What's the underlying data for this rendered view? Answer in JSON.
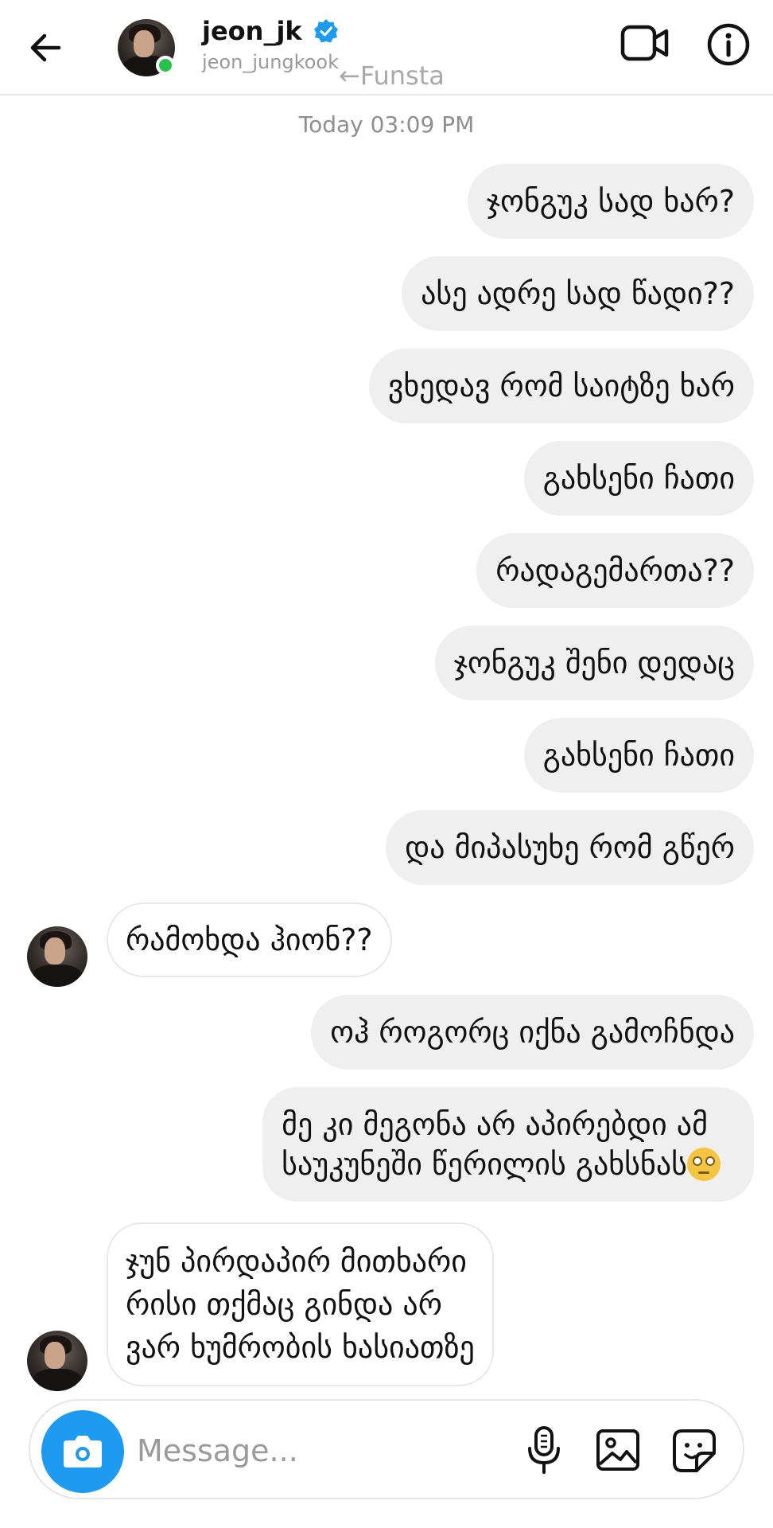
{
  "header": {
    "display_name": "jeon_jk",
    "username": "jeon_jungkook",
    "watermark": "←Funsta",
    "icons": {
      "back": "back-arrow-icon",
      "verified": "verified-badge-icon",
      "video": "video-call-icon",
      "info": "info-icon"
    },
    "colors": {
      "verified": "#1d9bf0",
      "online": "#27c24c"
    }
  },
  "thread": {
    "timestamp": "Today 03:09 PM",
    "messages": [
      {
        "from": "me",
        "text": "ჯონგუკ სად ხარ?"
      },
      {
        "from": "me",
        "text": "ასე ადრე სად წადი??"
      },
      {
        "from": "me",
        "text": "ვხედავ რომ საიტზე ხარ"
      },
      {
        "from": "me",
        "text": "გახსენი ჩათი"
      },
      {
        "from": "me",
        "text": "რადაგემართა??"
      },
      {
        "from": "me",
        "text": "ჯონგუკ შენი დედაც"
      },
      {
        "from": "me",
        "text": "გახსენი ჩათი"
      },
      {
        "from": "me",
        "text": "და მიპასუხე რომ გწერ"
      },
      {
        "from": "them",
        "text": "რამოხდა ჰიონ??"
      },
      {
        "from": "me",
        "text": "ოჰ როგორც იქნა გამოჩნდა"
      },
      {
        "from": "me",
        "lines": [
          "მე კი მეგონა არ აპირებდი ამ",
          "საუკუნეში წერილის გახსნას"
        ],
        "emoji": "face-with-rolling-eyes"
      },
      {
        "from": "them",
        "lines": [
          "ჯუნ პირდაპირ მითხარი",
          "რისი თქმაც გინდა არ",
          "ვარ ხუმრობის ხასიათზე"
        ]
      }
    ],
    "colors": {
      "outgoing_bubble": "#efefef",
      "incoming_border": "#e8e8e8"
    }
  },
  "composer": {
    "placeholder": "Message...",
    "icons": {
      "camera": "camera-icon",
      "mic": "microphone-icon",
      "gallery": "gallery-icon",
      "sticker": "sticker-icon"
    },
    "colors": {
      "camera_button": "#1d9bf0"
    }
  }
}
